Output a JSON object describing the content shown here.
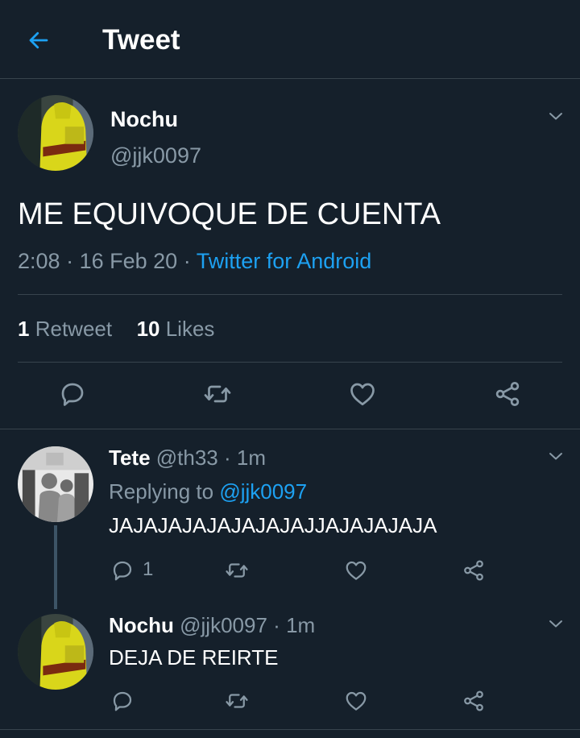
{
  "header": {
    "title": "Tweet"
  },
  "main_tweet": {
    "display_name": "Nochu",
    "handle": "@jjk0097",
    "text": "ME EQUIVOQUE DE CUENTA",
    "time": "2:08",
    "sep1": "·",
    "date": "16 Feb 20",
    "sep2": "·",
    "client": "Twitter for Android",
    "retweet_count": "1",
    "retweet_label": "Retweet",
    "like_count": "10",
    "like_label": "Likes"
  },
  "replies": [
    {
      "display_name": "Tete",
      "handle": "@th33",
      "dot": "·",
      "time": "1m",
      "replying_prefix": "Replying to",
      "replying_handle": "@jjk0097",
      "text": "JAJAJAJAJAJAJAJAJJAJAJAJAJA",
      "reply_count": "1"
    },
    {
      "display_name": "Nochu",
      "handle": "@jjk0097",
      "dot": "·",
      "time": "1m",
      "text": "DEJA DE REIRTE"
    }
  ],
  "icons": {
    "back": "arrow-left-icon",
    "more": "chevron-down-icon",
    "reply": "reply-icon",
    "retweet": "retweet-icon",
    "like": "heart-icon",
    "share": "share-icon"
  },
  "colors": {
    "background": "#15202b",
    "accent": "#1da1f2",
    "secondary_text": "#8899a6",
    "divider": "#38444d",
    "thread_line": "#3d5466"
  }
}
